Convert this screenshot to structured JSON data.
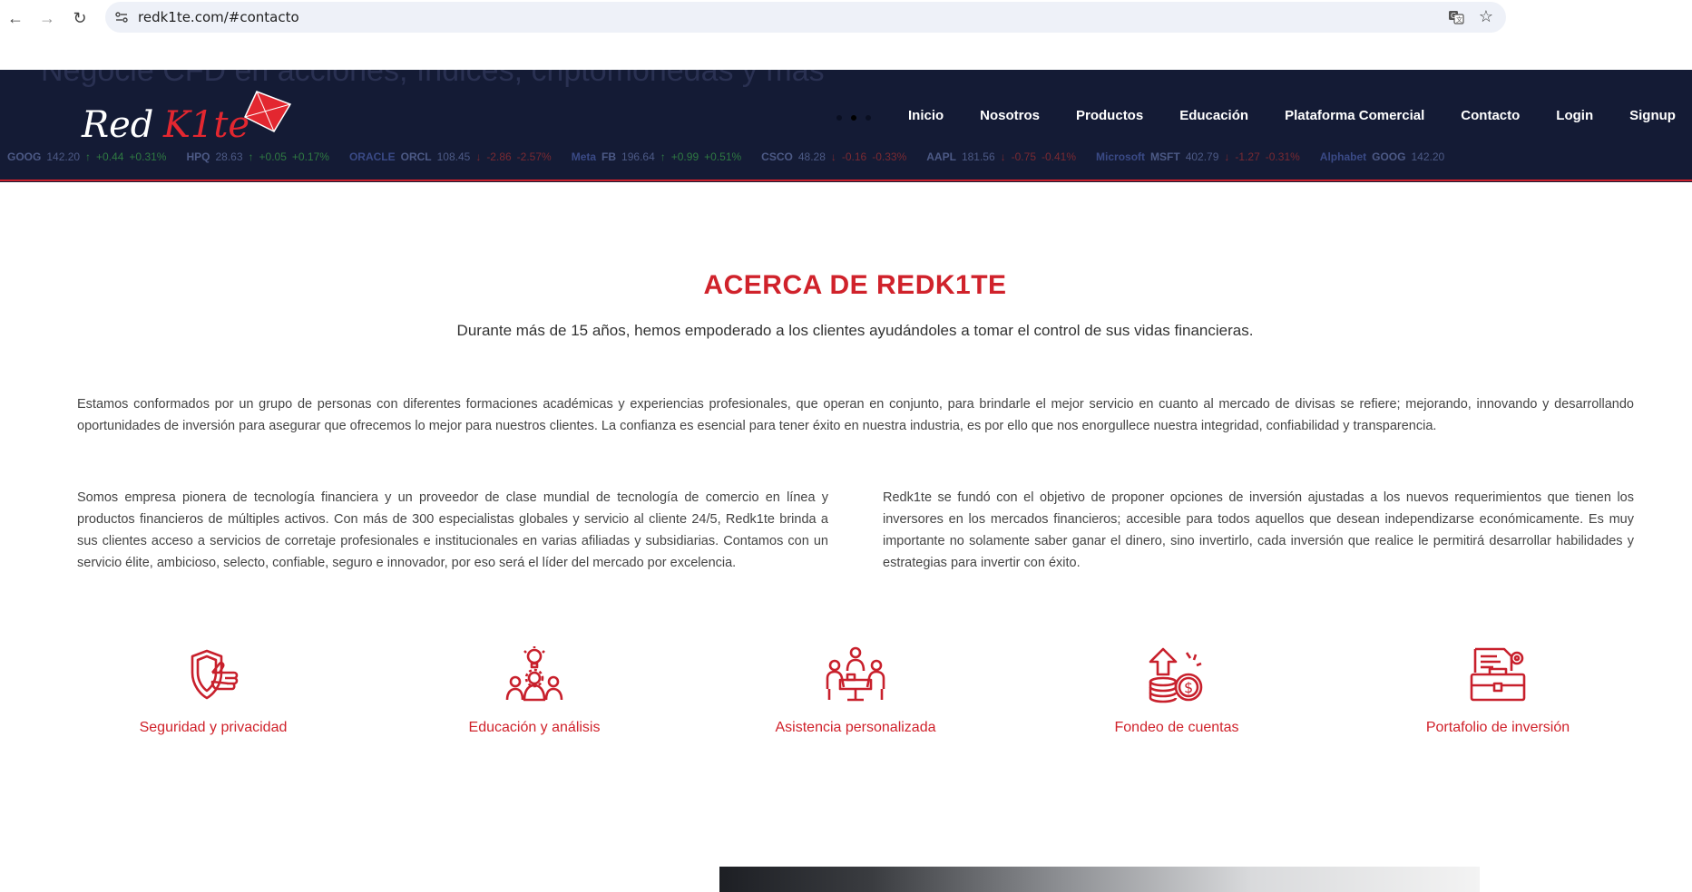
{
  "browser": {
    "url": "redk1te.com/#contacto"
  },
  "header": {
    "hero_text": "Negocie CFD en acciones, índices, criptomonedas y más",
    "logo_text": "Red K1te",
    "menu": [
      "Inicio",
      "Nosotros",
      "Productos",
      "Educación",
      "Plataforma Comercial",
      "Contacto",
      "Login",
      "Signup"
    ],
    "ticker": [
      {
        "brand": "",
        "symbol": "GOOG",
        "price": "142.20",
        "change": "+0.44",
        "pct": "+0.31%",
        "dir": "up"
      },
      {
        "brand": "",
        "symbol": "HPQ",
        "price": "28.63",
        "change": "+0.05",
        "pct": "+0.17%",
        "dir": "up"
      },
      {
        "brand": "ORACLE",
        "symbol": "ORCL",
        "price": "108.45",
        "change": "-2.86",
        "pct": "-2.57%",
        "dir": "down"
      },
      {
        "brand": "Meta",
        "symbol": "FB",
        "price": "196.64",
        "change": "+0.99",
        "pct": "+0.51%",
        "dir": "up"
      },
      {
        "brand": "",
        "symbol": "CSCO",
        "price": "48.28",
        "change": "-0.16",
        "pct": "-0.33%",
        "dir": "down"
      },
      {
        "brand": "",
        "symbol": "AAPL",
        "price": "181.56",
        "change": "-0.75",
        "pct": "-0.41%",
        "dir": "down"
      },
      {
        "brand": "Microsoft",
        "symbol": "MSFT",
        "price": "402.79",
        "change": "-1.27",
        "pct": "-0.31%",
        "dir": "down"
      },
      {
        "brand": "Alphabet",
        "symbol": "GOOG",
        "price": "142.20",
        "change": "",
        "pct": "",
        "dir": ""
      }
    ]
  },
  "about": {
    "title": "ACERCA DE REDK1TE",
    "subtitle": "Durante más de 15 años, hemos empoderado a los clientes ayudándoles a tomar el control de sus vidas financieras.",
    "p1": "Estamos conformados por un grupo de personas con diferentes formaciones académicas y experiencias profesionales, que operan en conjunto, para brindarle el mejor servicio en cuanto al mercado de divisas se refiere; mejorando, innovando y desarrollando oportunidades de inversión para asegurar que ofrecemos lo mejor para nuestros clientes. La confianza es esencial para tener éxito en nuestra industria, es por ello que nos enorgullece nuestra integridad, confiabilidad y transparencia.",
    "p2": "Somos empresa pionera de tecnología financiera y un proveedor de clase mundial de tecnología de comercio en línea y productos financieros de múltiples activos. Con más de 300 especialistas globales y servicio al cliente 24/5, Redk1te brinda a sus clientes acceso a servicios de corretaje profesionales e institucionales en varias afiliadas y subsidiarias. Contamos con un servicio élite, ambicioso, selecto, confiable, seguro e innovador, por eso será el líder del mercado por excelencia.",
    "p3": "Redk1te se fundó con el objetivo de proponer opciones de inversión ajustadas a los nuevos requerimientos que tienen los inversores en los mercados financieros; accesible para todos aquellos que desean independizarse económicamente. Es muy importante no solamente saber ganar el dinero, sino invertirlo, cada inversión que realice le permitirá desarrollar habilidades y estrategias para invertir con éxito."
  },
  "features": [
    {
      "label": "Seguridad y privacidad",
      "icon": "security-hand-icon"
    },
    {
      "label": "Educación y análisis",
      "icon": "education-analysis-icon"
    },
    {
      "label": "Asistencia personalizada",
      "icon": "personal-assistance-icon"
    },
    {
      "label": "Fondeo de cuentas",
      "icon": "account-funding-icon"
    },
    {
      "label": "Portafolio de inversión",
      "icon": "investment-portfolio-icon"
    }
  ],
  "colors": {
    "accent": "#d0222b",
    "header_bg": "#141b35"
  }
}
